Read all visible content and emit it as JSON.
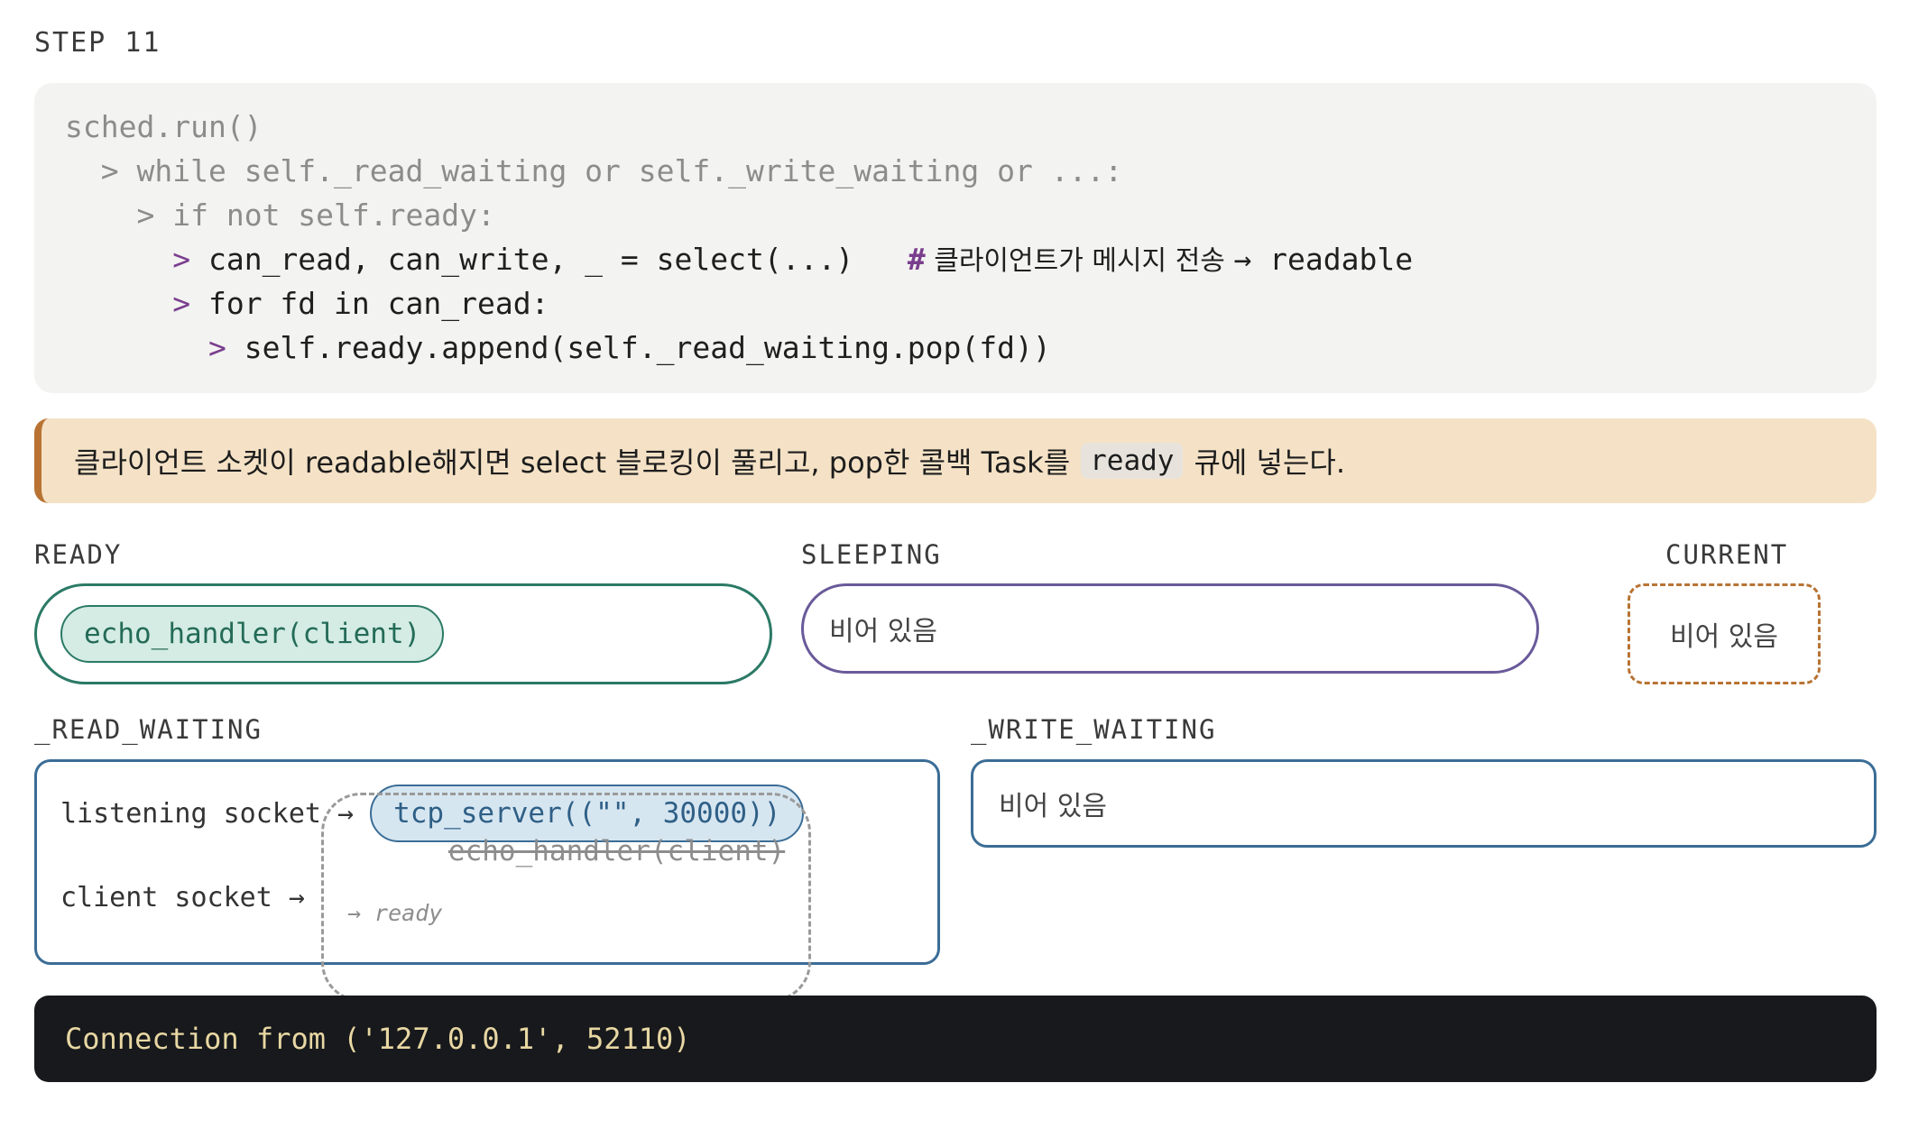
{
  "step": {
    "label": "STEP 11"
  },
  "code": {
    "lines": [
      {
        "indent": "",
        "arrow": "",
        "text": "sched.run()"
      },
      {
        "indent": "  ",
        "arrow": ">",
        "text": " while self._read_waiting or self._write_waiting or ...:"
      },
      {
        "indent": "    ",
        "arrow": ">",
        "text": " if not self.ready:"
      },
      {
        "indent": "      ",
        "arrow": ">",
        "text": " can_read, can_write, _ = select(...)   ",
        "comment_hash": "#",
        "comment_text": " 클라이언트가 메시지 전송 ",
        "comment_tail": "→ readable"
      },
      {
        "indent": "      ",
        "arrow": ">",
        "text": " for fd in can_read:"
      },
      {
        "indent": "        ",
        "arrow": ">",
        "text": " self.ready.append(self._read_waiting.pop(fd))"
      }
    ]
  },
  "note": {
    "before": "클라이언트 소켓이 readable해지면 select 블로킹이 풀리고, pop한 콜백 Task를",
    "code": "ready",
    "after": "큐에 넣는다."
  },
  "queues": {
    "ready": {
      "label": "READY",
      "tasks": [
        "echo_handler(client)"
      ]
    },
    "sleeping": {
      "label": "SLEEPING",
      "empty": "비어 있음"
    },
    "current": {
      "label": "CURRENT",
      "empty": "비어 있음"
    },
    "read_waiting": {
      "label": "_READ_WAITING",
      "rows": [
        {
          "fd": "listening socket →",
          "task": "tcp_server((\"\", 30000))"
        },
        {
          "fd": "client socket →",
          "task": "echo_handler(client)",
          "moved": "→ ready"
        }
      ]
    },
    "write_waiting": {
      "label": "_WRITE_WAITING",
      "empty": "비어 있음"
    }
  },
  "console": {
    "output": "Connection from ('127.0.0.1', 52110)"
  },
  "colors": {
    "ready": "#2b7a66",
    "sleeping": "#6a5a9a",
    "current": "#b87333",
    "waiting": "#3b6d96",
    "arrow": "#7a3e8e",
    "console_bg": "#17191c",
    "console_text": "#e8d7a3",
    "note_bg": "#f5e2c6"
  }
}
